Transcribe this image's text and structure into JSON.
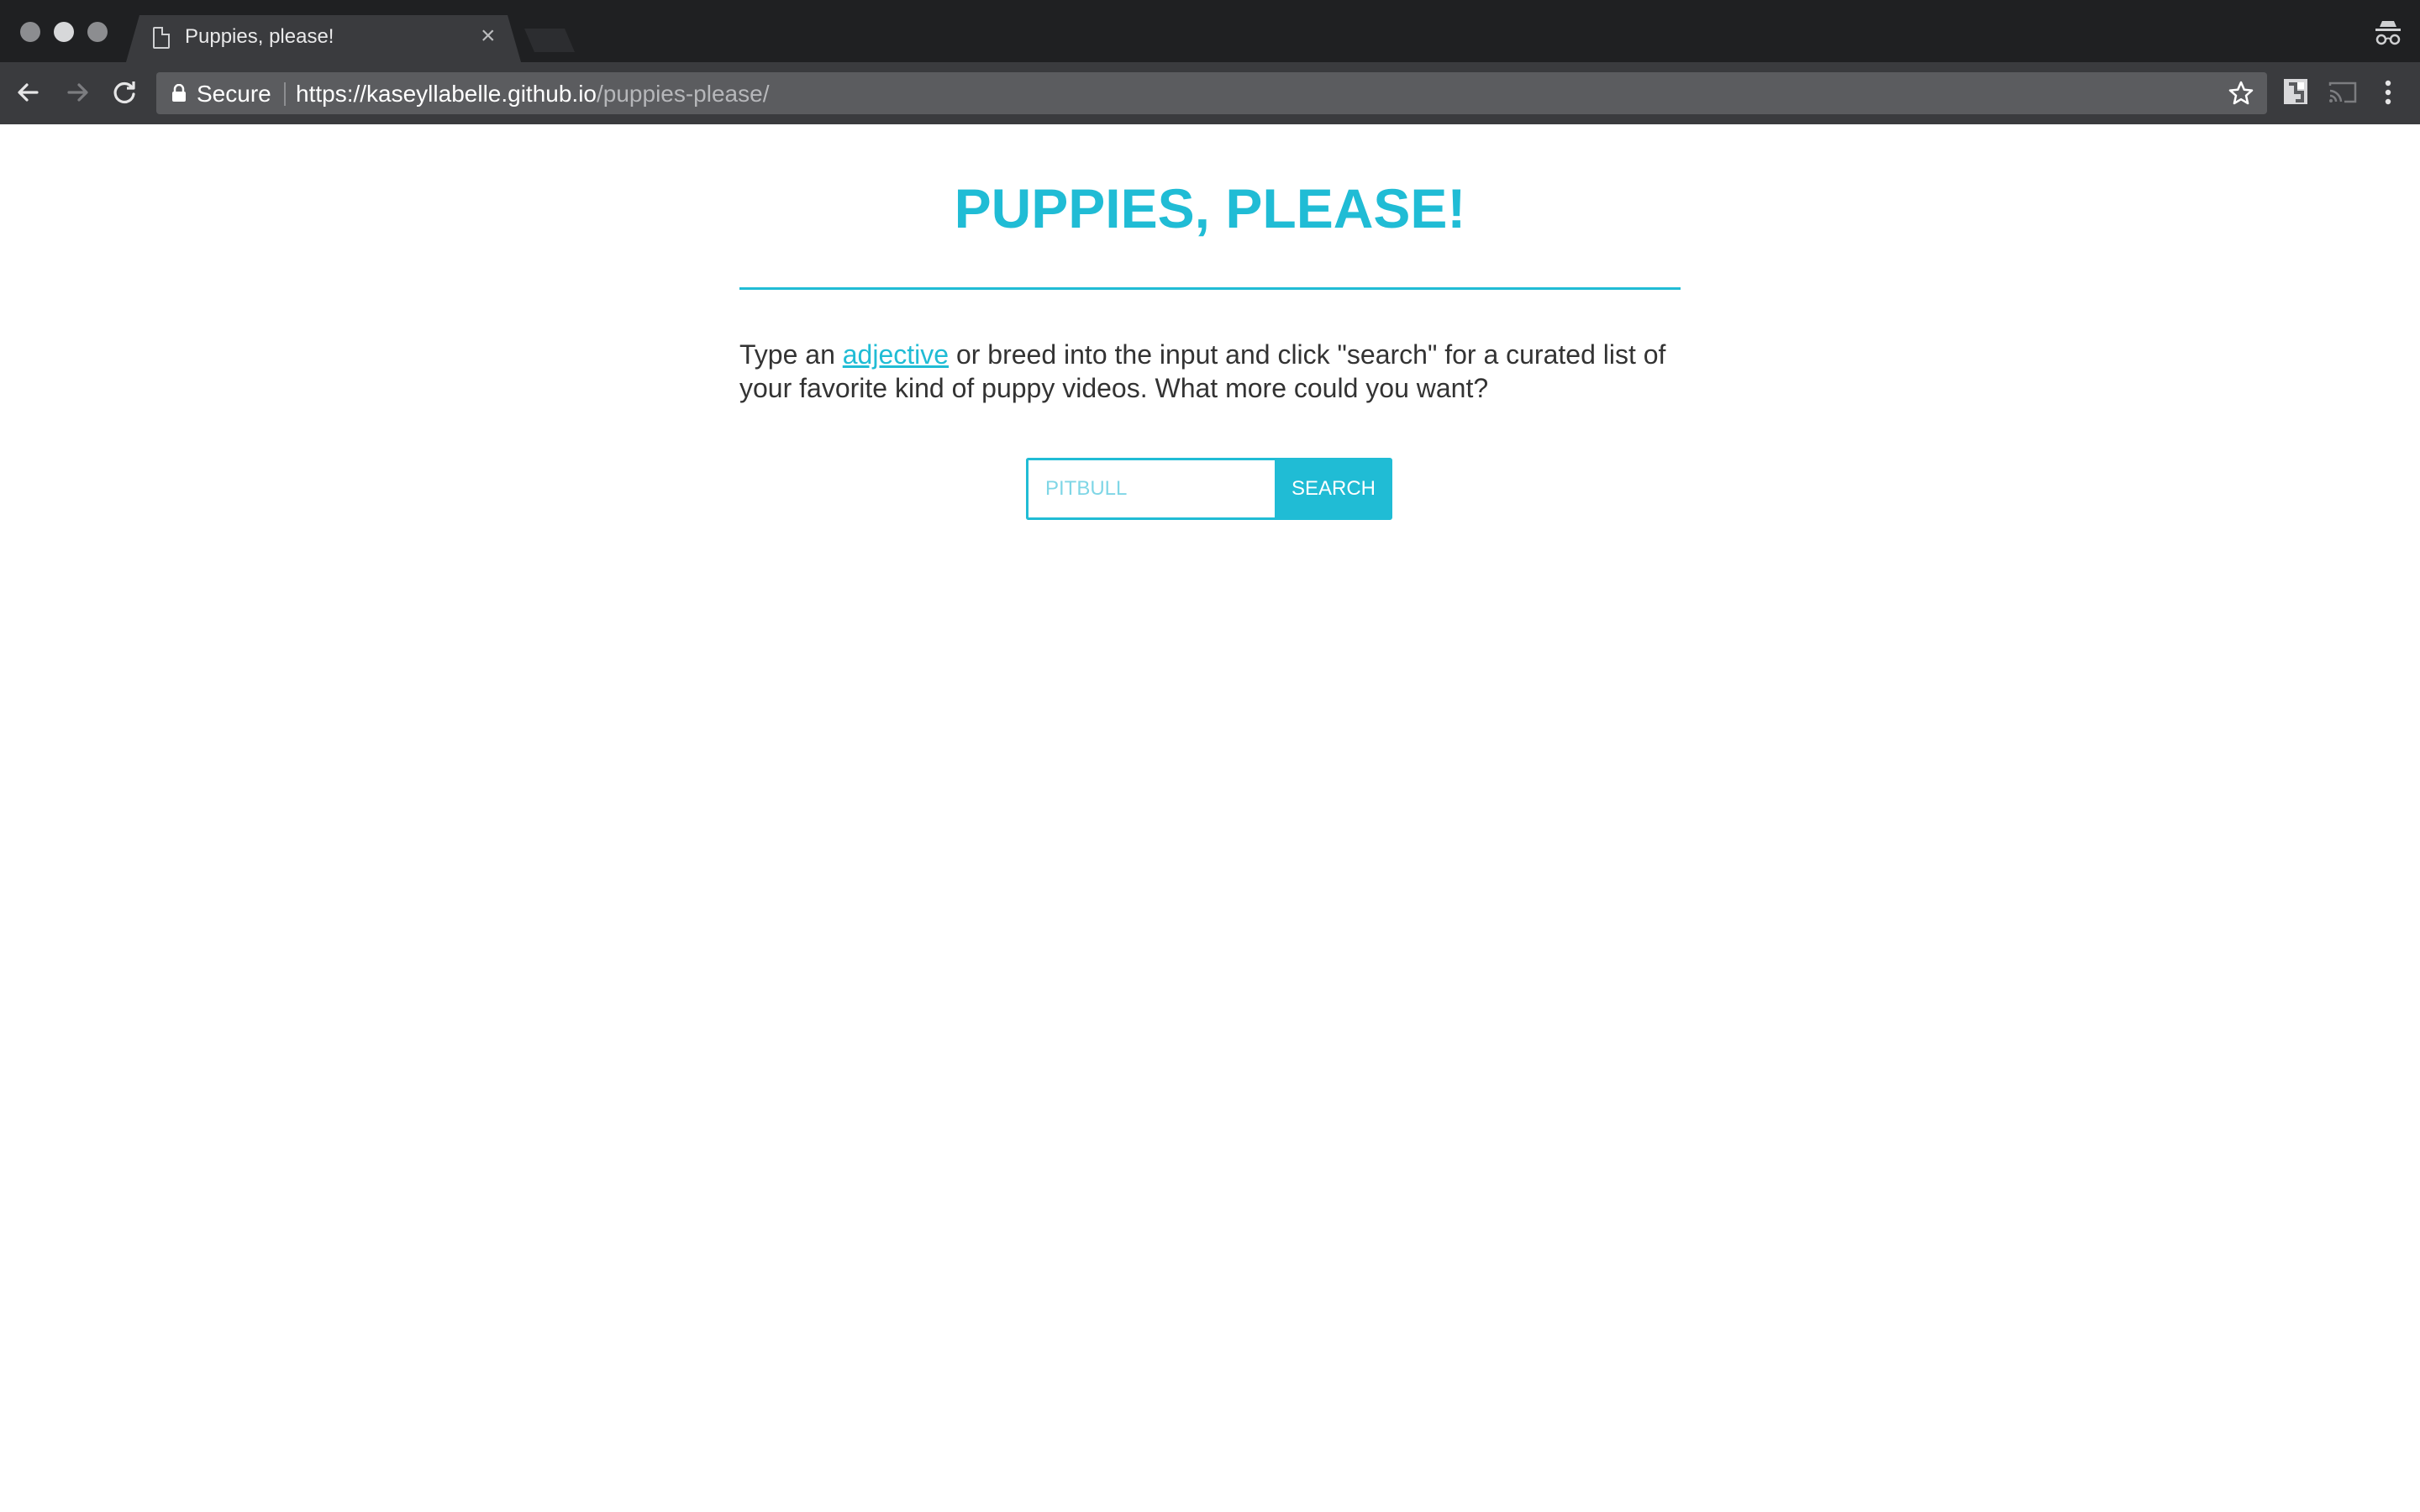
{
  "browser": {
    "tab_title": "Puppies, please!",
    "tab_close": "×",
    "secure_label": "Secure",
    "url_host": "https://kaseyllabelle.github.io",
    "url_path": "/puppies-please/",
    "colors": {
      "tabbar": "#1f2022",
      "toolbar": "#3a3b3e",
      "omnibox": "#5b5c5f"
    }
  },
  "page": {
    "title": "PUPPIES, PLEASE!",
    "intro_before": "Type an ",
    "intro_link": "adjective",
    "intro_after": " or breed into the input and click \"search\" for a curated list of your favorite kind of puppy videos. What more could you want?",
    "search": {
      "placeholder": "PITBULL",
      "value": "",
      "button_label": "SEARCH"
    },
    "accent_color": "#20bcd5"
  }
}
